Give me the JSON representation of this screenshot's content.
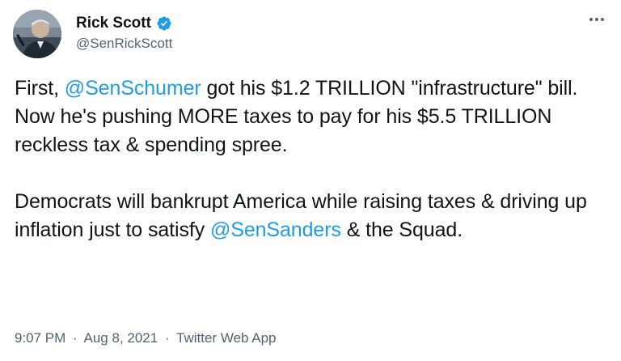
{
  "author": {
    "display_name": "Rick Scott",
    "handle": "@SenRickScott",
    "verified_icon": "verified-badge-icon",
    "avatar_icon": "avatar"
  },
  "menu_icon": "more-options-icon",
  "tweet": {
    "p1": {
      "t1": "First, ",
      "m1": "@SenSchumer",
      "t2": " got his $1.2 TRILLION \"infrastructure\" bill. Now he's pushing MORE taxes to pay for his $5.5 TRILLION reckless tax & spending spree."
    },
    "p2": {
      "t1": "Democrats will bankrupt America while raising taxes & driving up inflation just to satisfy ",
      "m1": "@SenSanders",
      "t2": " & the Squad."
    }
  },
  "meta": {
    "time": "9:07 PM",
    "sep1": "·",
    "date": "Aug 8, 2021",
    "sep2": "·",
    "app": "Twitter Web App"
  },
  "colors": {
    "accent": "#1d9bf0",
    "text": "#0f1419",
    "secondary": "#536471"
  }
}
